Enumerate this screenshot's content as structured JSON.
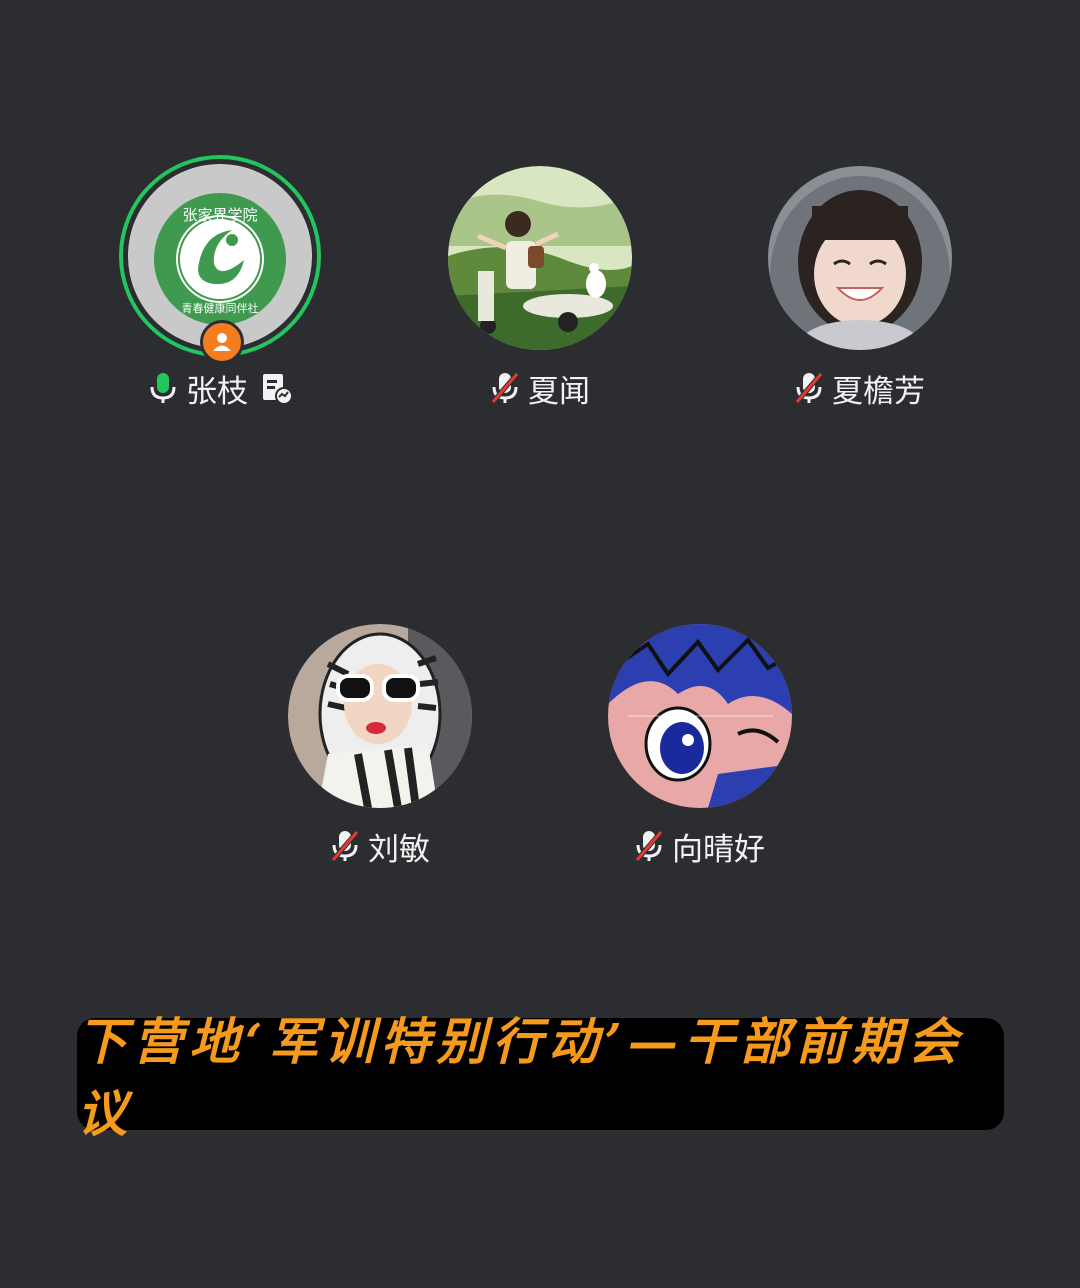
{
  "participants": [
    {
      "name": "张枝",
      "mic": "on",
      "speaking": true,
      "host": true,
      "avatar": "school-club-logo",
      "logo_top": "张家界学院",
      "logo_bottom": "青春健康同伴社"
    },
    {
      "name": "夏闻",
      "mic": "muted",
      "avatar": "girl-illustration"
    },
    {
      "name": "夏檐芳",
      "mic": "muted",
      "avatar": "smiling-girl-photo"
    },
    {
      "name": "刘敏",
      "mic": "muted",
      "avatar": "sunglasses-scarf-photo"
    },
    {
      "name": "向晴好",
      "mic": "muted",
      "avatar": "anime-character"
    }
  ],
  "meeting_title": "下营地‘军训特别行动’—干部前期会议",
  "colors": {
    "background": "#2c2d31",
    "speaking": "#22c55e",
    "host_badge": "#f57c1f",
    "title": "#f59a1c",
    "mute_slash": "#e53935"
  }
}
